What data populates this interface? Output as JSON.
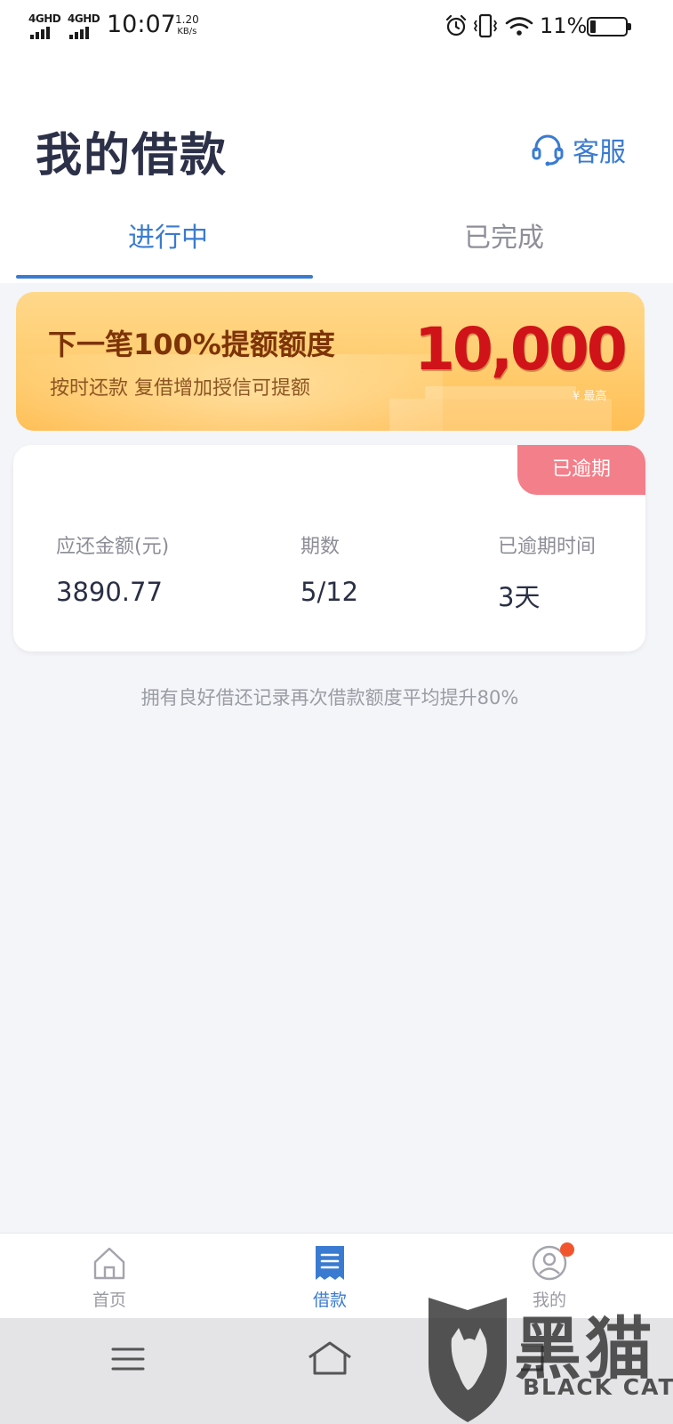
{
  "status_bar": {
    "network_1": "4GHD",
    "network_2": "4GHD",
    "time": "10:07",
    "speed_value": "1.20",
    "speed_unit": "KB/s",
    "battery_percent": "11%",
    "battery_level": 0.11,
    "icons": [
      "signal-icon",
      "alarm-icon",
      "vibrate-icon",
      "wifi-icon",
      "battery-icon"
    ]
  },
  "header": {
    "title": "我的借款",
    "service_label": "客服",
    "service_icon": "headset-icon"
  },
  "tabs": [
    {
      "label": "进行中",
      "active": true
    },
    {
      "label": "已完成",
      "active": false
    }
  ],
  "banner": {
    "title": "下一笔100%提额额度",
    "subtitle": "按时还款  复借增加授信可提额",
    "amount": "10,000",
    "amount_caption": "¥ 最高"
  },
  "loan_card": {
    "badge": "已逾期",
    "stats": [
      {
        "label": "应还金额(元)",
        "value": "3890.77"
      },
      {
        "label": "期数",
        "value": "5/12"
      },
      {
        "label": "已逾期时间",
        "value": "3天"
      }
    ]
  },
  "tip": "拥有良好借还记录再次借款额度平均提升80%",
  "bottom_nav": [
    {
      "label": "首页",
      "icon": "home-icon",
      "active": false
    },
    {
      "label": "借款",
      "icon": "receipt-icon",
      "active": true
    },
    {
      "label": "我的",
      "icon": "user-icon",
      "active": false,
      "has_dot": true
    }
  ],
  "system_nav": [
    "menu-icon",
    "home-icon",
    "back-icon"
  ],
  "watermark": {
    "cn": "黑猫",
    "en": "BLACK CAT"
  },
  "colors": {
    "accent": "#3a7bd1",
    "title": "#2c3048",
    "overdue_badge": "#f27f89",
    "banner_amount": "#d01219",
    "page_bg": "#f4f5f8",
    "notification_dot": "#f2552d"
  }
}
